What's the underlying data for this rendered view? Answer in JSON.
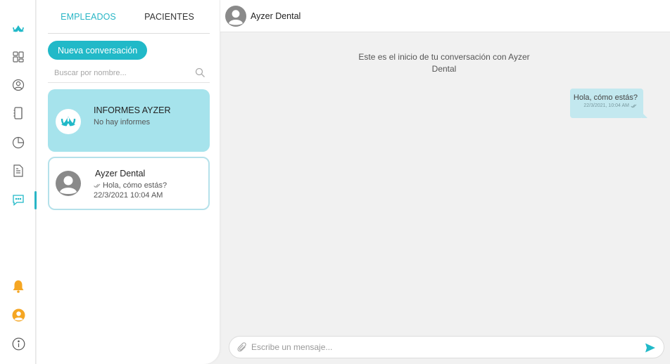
{
  "colors": {
    "accent": "#21b9c8",
    "informes_card": "#a6e3ec",
    "bubble": "#c3e8ef",
    "bell": "#f5a623",
    "avatar_gray": "#8a8a8a"
  },
  "sidebar": {
    "icons": [
      "ayzer-logo-icon",
      "dashboard-icon",
      "user-circle-icon",
      "agenda-icon",
      "pie-chart-icon",
      "document-icon",
      "chat-icon",
      "bell-icon",
      "profile-icon",
      "info-icon"
    ],
    "active": "chat-icon"
  },
  "tabs": [
    {
      "label": "EMPLEADOS",
      "active": true
    },
    {
      "label": "PACIENTES",
      "active": false
    }
  ],
  "new_conversation_label": "Nueva conversación",
  "search": {
    "placeholder": "Buscar por nombre..."
  },
  "conversations": [
    {
      "title": "INFORMES AYZER",
      "subtitle": "No hay informes"
    },
    {
      "title": "Ayzer Dental",
      "preview": "Hola, cómo estás?",
      "timestamp": "22/3/2021 10:04 AM"
    }
  ],
  "chat": {
    "contact_name": "Ayzer Dental",
    "start_notice": "Este es el inicio de tu conversación con Ayzer Dental",
    "messages": [
      {
        "text": "Hola, cómo estás?",
        "time": "22/3/2021, 10:04 AM"
      }
    ],
    "composer_placeholder": "Escribe un mensaje..."
  }
}
